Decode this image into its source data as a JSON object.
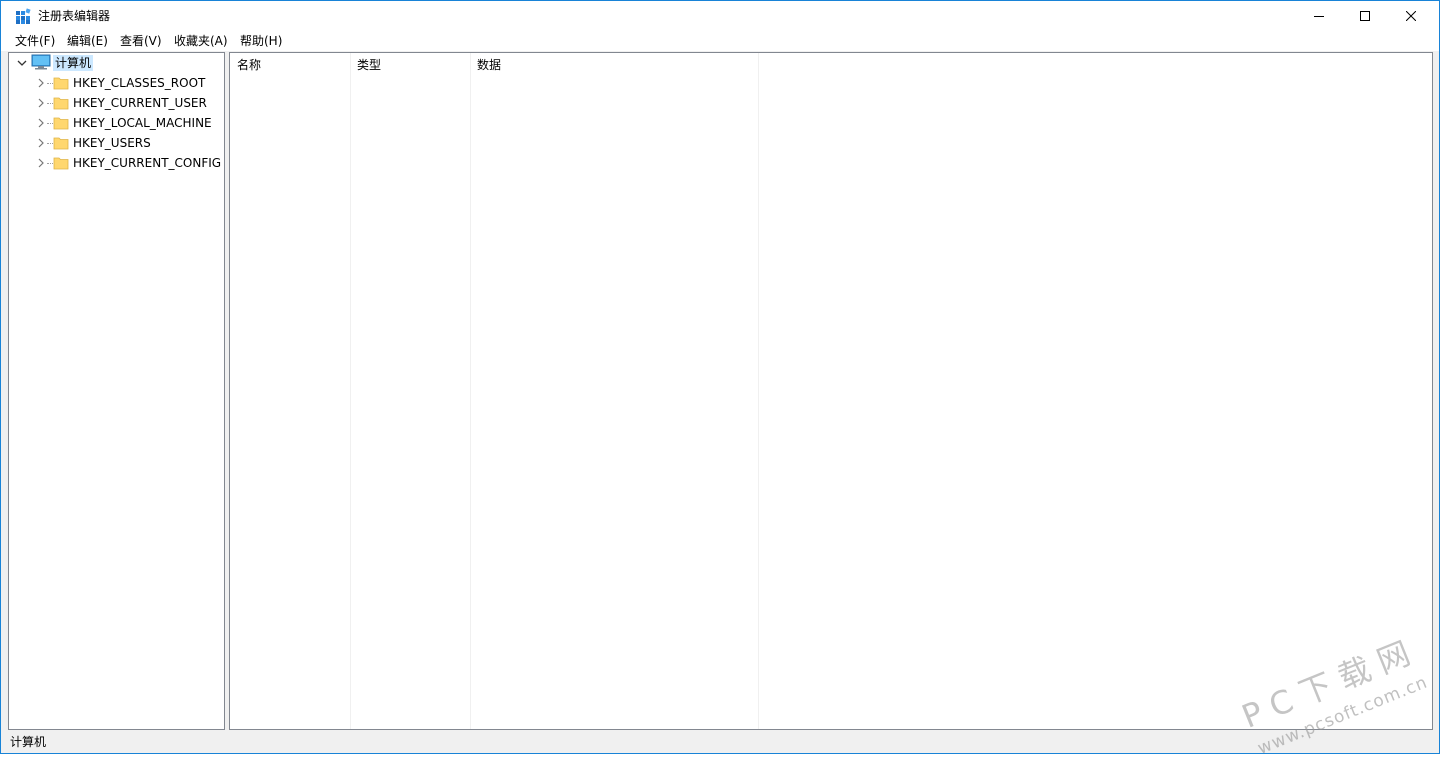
{
  "window": {
    "title": "注册表编辑器",
    "controls": {
      "minimize_icon": "minimize-icon",
      "maximize_icon": "maximize-icon",
      "close_icon": "close-icon"
    }
  },
  "menu": {
    "items": [
      {
        "label": "文件(F)"
      },
      {
        "label": "编辑(E)"
      },
      {
        "label": "查看(V)"
      },
      {
        "label": "收藏夹(A)"
      },
      {
        "label": "帮助(H)"
      }
    ]
  },
  "tree": {
    "root": {
      "label": "计算机",
      "icon": "computer-icon",
      "expanded": true
    },
    "children": [
      {
        "label": "HKEY_CLASSES_ROOT",
        "icon": "folder-icon"
      },
      {
        "label": "HKEY_CURRENT_USER",
        "icon": "folder-icon"
      },
      {
        "label": "HKEY_LOCAL_MACHINE",
        "icon": "folder-icon"
      },
      {
        "label": "HKEY_USERS",
        "icon": "folder-icon"
      },
      {
        "label": "HKEY_CURRENT_CONFIG",
        "icon": "folder-icon"
      }
    ]
  },
  "list": {
    "columns": [
      {
        "label": "名称"
      },
      {
        "label": "类型"
      },
      {
        "label": "数据"
      }
    ],
    "rows": []
  },
  "status": {
    "path": "计算机"
  },
  "watermark": {
    "main": "PC下载网",
    "sub": "www.pcsoft.com.cn"
  },
  "colors": {
    "accent": "#1883d7",
    "selection": "#cce8ff",
    "folder": "#ffd76e"
  }
}
